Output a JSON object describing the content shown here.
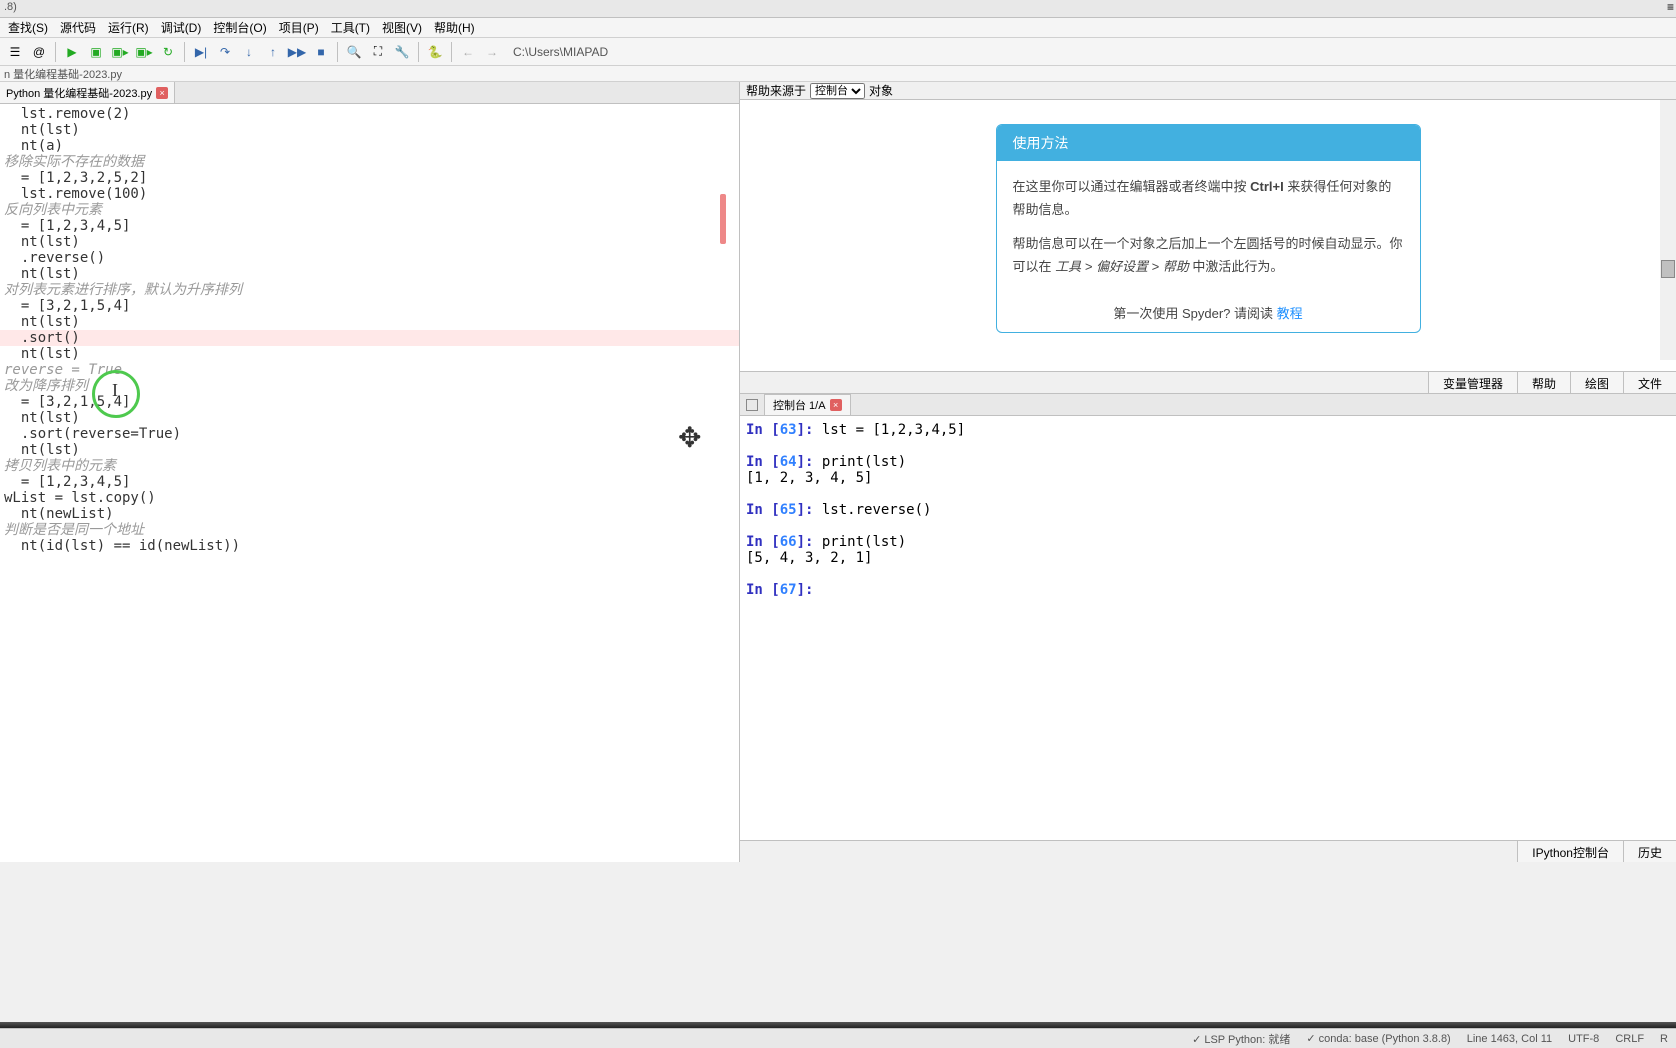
{
  "title_fragment": ".8)",
  "menu": [
    "查找(S)",
    "源代码",
    "运行(R)",
    "调试(D)",
    "控制台(O)",
    "项目(P)",
    "工具(T)",
    "视图(V)",
    "帮助(H)"
  ],
  "path": "C:\\Users\\MIAPAD",
  "breadcrumb": "n 量化编程基础-2023.py",
  "editor_tab": "Python 量化编程基础-2023.py",
  "code": [
    {
      "t": "  lst.remove(2)"
    },
    {
      "t": "  nt(lst)"
    },
    {
      "t": "  nt(a)"
    },
    {
      "t": ""
    },
    {
      "t": ""
    },
    {
      "t": "移除实际不存在的数据",
      "c": true
    },
    {
      "t": "  = [1,2,3,2,5,2]"
    },
    {
      "t": "  lst.remove(100)"
    },
    {
      "t": ""
    },
    {
      "t": ""
    },
    {
      "t": "反向列表中元素",
      "c": true
    },
    {
      "t": "  = [1,2,3,4,5]"
    },
    {
      "t": "  nt(lst)"
    },
    {
      "t": ""
    },
    {
      "t": "  .reverse()"
    },
    {
      "t": "  nt(lst)"
    },
    {
      "t": ""
    },
    {
      "t": ""
    },
    {
      "t": ""
    },
    {
      "t": "对列表元素进行排序，默认为升序排列",
      "c": true
    },
    {
      "t": "  = [3,2,1,5,4]"
    },
    {
      "t": "  nt(lst)"
    },
    {
      "t": ""
    },
    {
      "t": "  .sort()",
      "active": true
    },
    {
      "t": "  nt(lst)"
    },
    {
      "t": ""
    },
    {
      "t": ""
    },
    {
      "t": ""
    },
    {
      "t": "reverse = True",
      "c": true
    },
    {
      "t": "改为降序排列",
      "c": true
    },
    {
      "t": "  = [3,2,1,5,4]"
    },
    {
      "t": "  nt(lst)"
    },
    {
      "t": ""
    },
    {
      "t": "  .sort(reverse=True)"
    },
    {
      "t": "  nt(lst)"
    },
    {
      "t": ""
    },
    {
      "t": ""
    },
    {
      "t": ""
    },
    {
      "t": "拷贝列表中的元素",
      "c": true
    },
    {
      "t": "  = [1,2,3,4,5]"
    },
    {
      "t": "wList = lst.copy()"
    },
    {
      "t": ""
    },
    {
      "t": "  nt(newList)"
    },
    {
      "t": ""
    },
    {
      "t": "判断是否是同一个地址",
      "c": true
    },
    {
      "t": "  nt(id(lst) == id(newList))"
    }
  ],
  "help": {
    "source_label": "帮助来源于",
    "source_value": "控制台",
    "object_label": "对象",
    "title": "使用方法",
    "p1a": "在这里你可以通过在编辑器或者终端中按 ",
    "p1b": "Ctrl+I",
    "p1c": " 来获得任何对象的帮助信息。",
    "p2a": "帮助信息可以在一个对象之后加上一个左圆括号的时候自动显示。你可以在 ",
    "p2b": "工具 > 偏好设置 > 帮助",
    "p2c": " 中激活此行为。",
    "footer_text": "第一次使用 Spyder? 请阅读 ",
    "footer_link": "教程"
  },
  "help_tabs": [
    "变量管理器",
    "帮助",
    "绘图",
    "文件"
  ],
  "console_tab": "控制台 1/A",
  "console": [
    {
      "p": "In [",
      "n": "63",
      "s": "]: ",
      "c": "lst = [1,2,3,4,5]"
    },
    {
      "blank": true
    },
    {
      "p": "In [",
      "n": "64",
      "s": "]: ",
      "c": "print(lst)"
    },
    {
      "out": "[1, 2, 3, 4, 5]"
    },
    {
      "blank": true
    },
    {
      "p": "In [",
      "n": "65",
      "s": "]: ",
      "c": "lst.reverse()"
    },
    {
      "blank": true
    },
    {
      "p": "In [",
      "n": "66",
      "s": "]: ",
      "c": "print(lst)"
    },
    {
      "out": "[5, 4, 3, 2, 1]"
    },
    {
      "blank": true
    },
    {
      "p": "In [",
      "n": "67",
      "s": "]: ",
      "c": ""
    }
  ],
  "console_footer": [
    "IPython控制台",
    "历史"
  ],
  "status": {
    "lsp": "✓ LSP Python: 就绪",
    "conda": "✓ conda: base (Python 3.8.8)",
    "pos": "Line 1463, Col 11",
    "enc": "UTF-8",
    "eol": "CRLF",
    "r": "R"
  }
}
